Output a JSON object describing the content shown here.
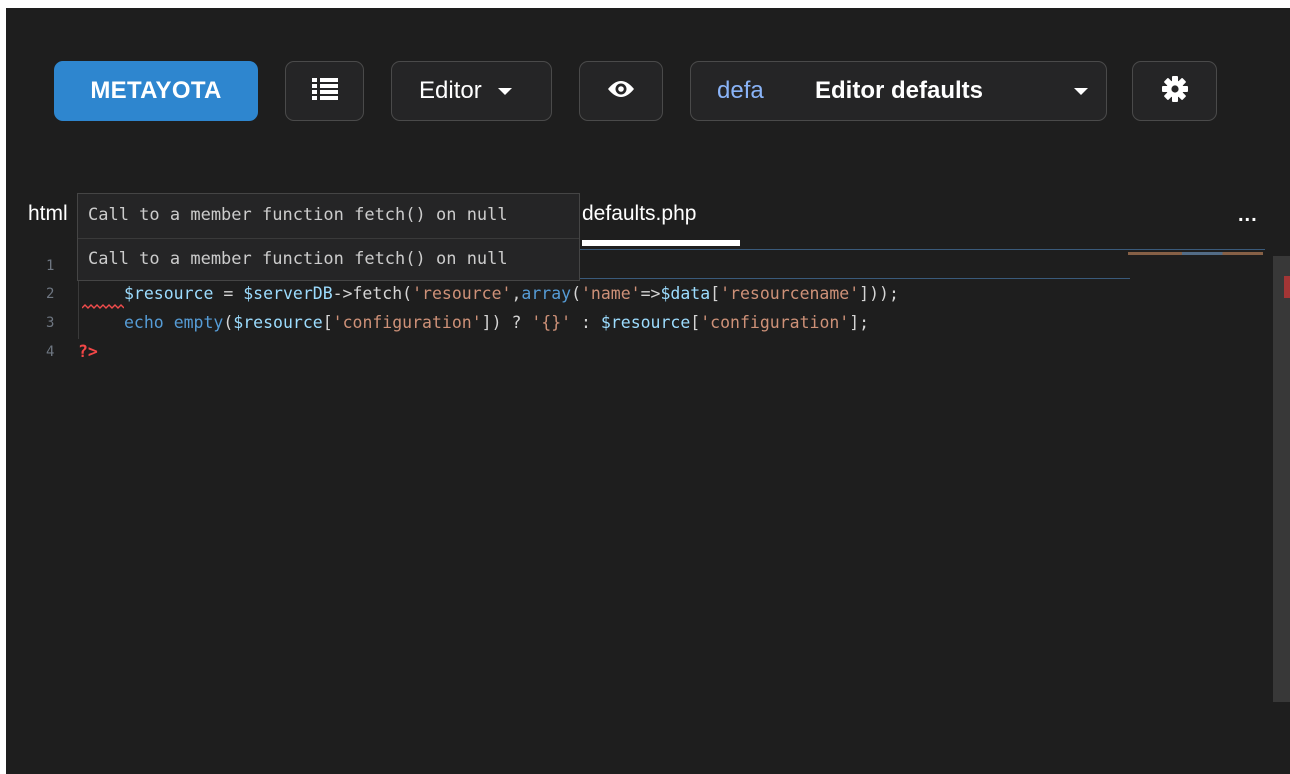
{
  "toolbar": {
    "brand_label": "METAYOTA",
    "list_icon": "list-icon",
    "editor_label": "Editor",
    "eye_icon": "eye-icon",
    "defaults_short": "defa",
    "defaults_label": "Editor defaults",
    "gear_icon": "gear-icon",
    "brand_color": "#2e86cf"
  },
  "tabs": {
    "left_label": "html",
    "active_label": "defaults.php",
    "more_label": "..."
  },
  "tooltip": {
    "line1": "Call to a member function fetch() on null",
    "line2": "Call to a member function fetch() on null"
  },
  "editor": {
    "line_numbers": [
      "1",
      "2",
      "3",
      "4"
    ],
    "line2": {
      "var1": "$resource",
      "op": " = ",
      "var2": "$serverDB",
      "arrow": "->fetch(",
      "str1": "'resource'",
      "comma": ",",
      "kw_array": "array",
      "open": "(",
      "str2": "'name'",
      "fat": "=>",
      "var3": "$data",
      "br1": "[",
      "str3": "'resourcename'",
      "end": "]));"
    },
    "line3": {
      "kw_echo": "echo",
      "space": " ",
      "fn_empty": "empty",
      "open": "(",
      "var1": "$resource",
      "br1": "[",
      "str1": "'configuration'",
      "mid": "]) ? ",
      "str2": "'{}'",
      "colon": " : ",
      "var2": "$resource",
      "br2": "[",
      "str3": "'configuration'",
      "end": "];"
    },
    "line4": "?>"
  }
}
